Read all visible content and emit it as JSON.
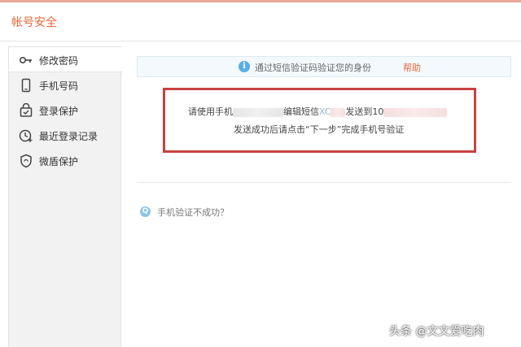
{
  "header": {
    "title": "帐号安全"
  },
  "sidebar": {
    "items": [
      {
        "label": "修改密码",
        "icon": "key-icon"
      },
      {
        "label": "手机号码",
        "icon": "phone-icon"
      },
      {
        "label": "登录保护",
        "icon": "shield-lock-icon"
      },
      {
        "label": "最近登录记录",
        "icon": "clock-plus-icon"
      },
      {
        "label": "微盾保护",
        "icon": "shield-icon"
      }
    ],
    "active_index": 0
  },
  "main": {
    "info": {
      "icon": "info-icon",
      "message": "通过短信验证码验证您的身份",
      "help_label": "帮助"
    },
    "instruction": {
      "part1": "请使用手机",
      "part2": "编辑短信",
      "code_prefix": "XC",
      "part3": "发送到",
      "number_prefix": "10",
      "line2": "发送成功后请点击“下一步”完成手机号验证"
    },
    "fail_link": {
      "icon": "q-icon",
      "icon_glyph": "Q",
      "label": "手机验证不成功？"
    }
  },
  "watermark": "头条 @文文爱吃肉",
  "colors": {
    "accent": "#e8663a",
    "highlight_border": "#c94141",
    "info_blue": "#5aaee6"
  }
}
